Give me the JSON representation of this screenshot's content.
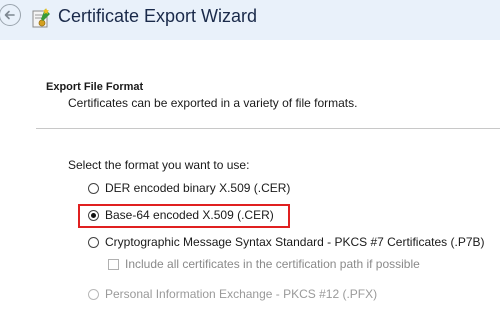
{
  "window": {
    "title": "Certificate Export Wizard",
    "back_icon": "back-arrow-icon",
    "wizard_icon": "certificate-wizard-icon"
  },
  "section": {
    "title": "Export File Format",
    "description": "Certificates can be exported in a variety of file formats."
  },
  "format_prompt": "Select the format you want to use:",
  "options": [
    {
      "label": "DER encoded binary X.509 (.CER)",
      "selected": false,
      "enabled": true
    },
    {
      "label": "Base-64 encoded X.509 (.CER)",
      "selected": true,
      "enabled": true
    },
    {
      "label": "Cryptographic Message Syntax Standard - PKCS #7 Certificates (.P7B)",
      "selected": false,
      "enabled": true
    },
    {
      "label": "Personal Information Exchange - PKCS #12 (.PFX)",
      "selected": false,
      "enabled": false
    }
  ],
  "include_all_certs": {
    "label": "Include all certificates in the certification path if possible",
    "checked": false,
    "enabled": false
  },
  "colors": {
    "highlight": "#e02020",
    "titlebar": "#e9f1fa"
  }
}
